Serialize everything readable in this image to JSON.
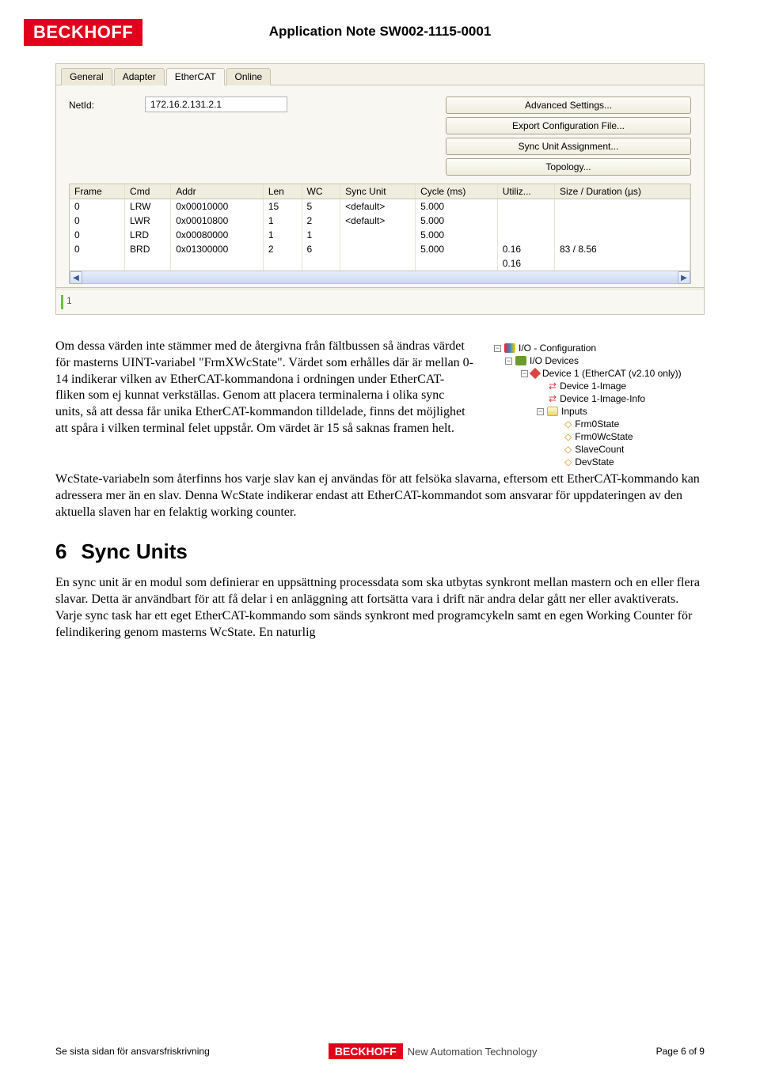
{
  "header": {
    "logo": "BECKHOFF",
    "title": "Application Note SW002-1115-0001"
  },
  "win": {
    "tabs": [
      "General",
      "Adapter",
      "EtherCAT",
      "Online"
    ],
    "active_tab_index": 2,
    "netid_label": "NetId:",
    "netid_value": "172.16.2.131.2.1",
    "buttons": [
      "Advanced Settings...",
      "Export Configuration File...",
      "Sync Unit Assignment...",
      "Topology..."
    ],
    "columns": [
      "Frame",
      "Cmd",
      "Addr",
      "Len",
      "WC",
      "Sync Unit",
      "Cycle (ms)",
      "Utiliz...",
      "Size / Duration (µs)"
    ],
    "rows": [
      [
        "0",
        "LRW",
        "0x00010000",
        "15",
        "5",
        "<default>",
        "5.000",
        "",
        ""
      ],
      [
        "0",
        "LWR",
        "0x00010800",
        "1",
        "2",
        "<default>",
        "5.000",
        "",
        ""
      ],
      [
        "0",
        "LRD",
        "0x00080000",
        "1",
        "1",
        "",
        "5.000",
        "",
        ""
      ],
      [
        "0",
        "BRD",
        "0x01300000",
        "2",
        "6",
        "",
        "5.000",
        "0.16",
        "83 / 8.56"
      ],
      [
        "",
        "",
        "",
        "",
        "",
        "",
        "",
        "0.16",
        ""
      ]
    ],
    "bottom_mark": "1"
  },
  "body": {
    "p1": "Om dessa värden inte stämmer med de återgivna från fältbussen så ändras värdet för masterns UINT-variabel \"FrmXWcState\". Värdet som erhålles där är mellan 0-14 indikerar vilken av EtherCAT-kommandona i ordningen under EtherCAT-fliken som ej kunnat verkställas. Genom att placera terminalerna i olika sync units, så att dessa får unika EtherCAT-kommandon tilldelade, finns det möjlighet att spåra i vilken terminal felet uppstår. Om värdet är 15 så saknas framen helt.",
    "p2": "WcState-variabeln som återfinns hos varje slav kan ej användas för att felsöka slavarna, eftersom ett EtherCAT-kommando kan adressera mer än en slav. Denna WcState indikerar endast att EtherCAT-kommandot som ansvarar för uppdateringen av den aktuella slaven har en felaktig working counter.",
    "h2_num": "6",
    "h2_text": "Sync Units",
    "p3": "En sync unit är en modul som definierar en uppsättning processdata som ska utbytas synkront mellan mastern och en eller flera slavar. Detta är användbart för att få delar i en anläggning att fortsätta vara i drift när andra delar gått ner eller avaktiverats. Varje sync task har ett eget EtherCAT-kommando som sänds synkront med programcykeln samt en egen Working Counter för felindikering genom masterns WcState. En naturlig"
  },
  "tree": [
    {
      "indent": 0,
      "exp": "-",
      "icon": "io",
      "label": "I/O - Configuration"
    },
    {
      "indent": 1,
      "exp": "-",
      "icon": "dev",
      "label": "I/O Devices"
    },
    {
      "indent": 2,
      "exp": "-",
      "icon": "node",
      "label": "Device 1 (EtherCAT (v2.10 only))"
    },
    {
      "indent": 3,
      "exp": "",
      "icon": "arrows",
      "label": "Device 1-Image"
    },
    {
      "indent": 3,
      "exp": "",
      "icon": "arrows",
      "label": "Device 1-Image-Info"
    },
    {
      "indent": 3,
      "exp": "-",
      "icon": "fold",
      "label": "Inputs"
    },
    {
      "indent": 4,
      "exp": "",
      "icon": "v",
      "label": "Frm0State"
    },
    {
      "indent": 4,
      "exp": "",
      "icon": "v",
      "label": "Frm0WcState"
    },
    {
      "indent": 4,
      "exp": "",
      "icon": "v",
      "label": "SlaveCount"
    },
    {
      "indent": 4,
      "exp": "",
      "icon": "v",
      "label": "DevState"
    }
  ],
  "footer": {
    "left": "Se sista sidan för ansvarsfriskrivning",
    "logo": "BECKHOFF",
    "tag": "New Automation Technology",
    "right": "Page 6 of 9"
  }
}
